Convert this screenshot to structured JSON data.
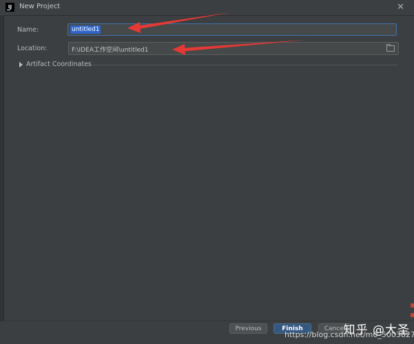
{
  "window": {
    "title": "New Project",
    "app_icon_text": "IJ",
    "close_glyph": "✕"
  },
  "form": {
    "name_label": "Name:",
    "name_value": "untitled1",
    "location_label": "Location:",
    "location_value": "F:\\IDEA工作空间\\untitled1",
    "artifact_label": "Artifact Coordinates"
  },
  "buttons": {
    "previous": "Previous",
    "finish": "Finish",
    "cancel": "Cancel"
  },
  "watermarks": {
    "zhihu": "知乎 @大圣",
    "url": "https://blog.csdn.net/m0_50038270"
  },
  "colors": {
    "background": "#3c3f41",
    "input": "#45494a",
    "focus_border": "#3f73a8",
    "selection": "#2f65ca",
    "finish_button": "#365880",
    "annotation_arrow": "#e53935"
  },
  "icons": [
    "app-icon",
    "close-icon",
    "folder-icon",
    "triangle-icon",
    "arrow-icon"
  ]
}
